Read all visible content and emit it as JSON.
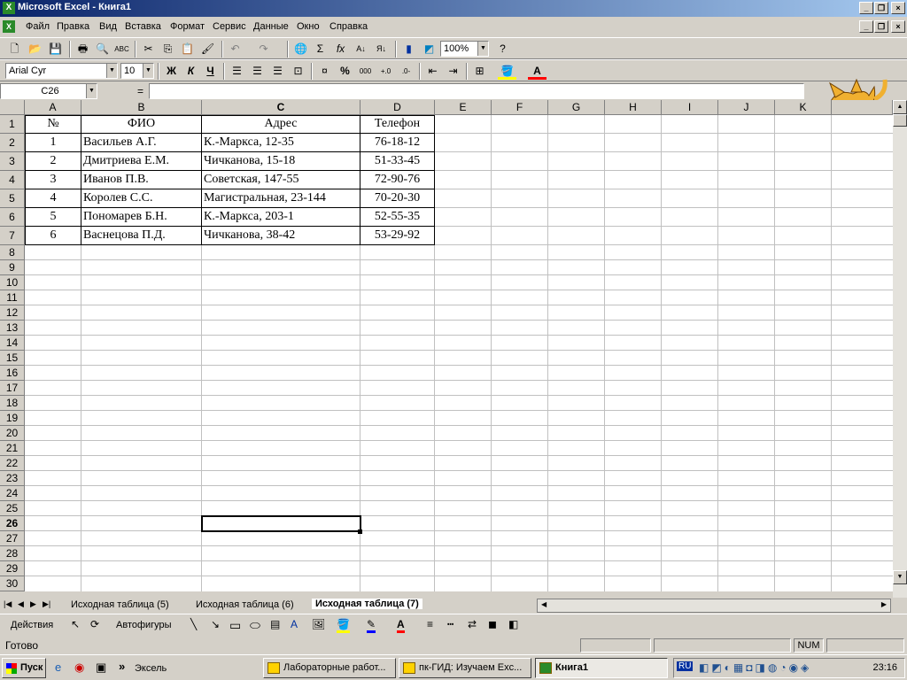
{
  "window": {
    "title": "Microsoft Excel - Книга1",
    "app_icon": "X"
  },
  "menu": [
    "Файл",
    "Правка",
    "Вид",
    "Вставка",
    "Формат",
    "Сервис",
    "Данные",
    "Окно",
    "Справка"
  ],
  "toolbar1": {
    "zoom": "100%"
  },
  "toolbar2": {
    "font": "Arial Cyr",
    "size": "10",
    "bold": "Ж",
    "italic": "К",
    "underline": "Ч",
    "percent": "%",
    "thousands": "000"
  },
  "formula_bar": {
    "name_box": "C26",
    "equals": "=",
    "value": ""
  },
  "columns": [
    "A",
    "B",
    "C",
    "D",
    "E",
    "F",
    "G",
    "H",
    "I",
    "J",
    "K"
  ],
  "rows": [
    "1",
    "2",
    "3",
    "4",
    "5",
    "6",
    "7",
    "8",
    "9",
    "10",
    "11",
    "12",
    "13",
    "14",
    "15",
    "16",
    "17",
    "18",
    "19",
    "20",
    "21",
    "22",
    "23",
    "24",
    "25",
    "26",
    "27",
    "28",
    "29",
    "30"
  ],
  "table": {
    "headers": [
      "№",
      "ФИО",
      "Адрес",
      "Телефон"
    ],
    "rows": [
      [
        "1",
        "Васильев А.Г.",
        "К.-Маркса, 12-35",
        "76-18-12"
      ],
      [
        "2",
        "Дмитриева Е.М.",
        "Чичканова, 15-18",
        "51-33-45"
      ],
      [
        "3",
        "Иванов П.В.",
        "Советская, 147-55",
        "72-90-76"
      ],
      [
        "4",
        "Королев С.С.",
        "Магистральная, 23-144",
        "70-20-30"
      ],
      [
        "5",
        "Пономарев Б.Н.",
        "К.-Маркса, 203-1",
        "52-55-35"
      ],
      [
        "6",
        "Васнецова П.Д.",
        "Чичканова, 38-42",
        "53-29-92"
      ]
    ]
  },
  "sheets": [
    "Исходная таблица (5)",
    "Исходная таблица (6)",
    "Исходная таблица (7)"
  ],
  "active_sheet": "Исходная таблица (7)",
  "drawing": {
    "actions": "Действия",
    "autoshapes": "Автофигуры"
  },
  "status": {
    "ready": "Готово",
    "num": "NUM"
  },
  "taskbar": {
    "start": "Пуск",
    "quick_more": "»",
    "folder": "Эксель",
    "tasks": [
      "Лабораторные работ...",
      "пк-ГИД: Изучаем Exc...",
      "Книга1"
    ],
    "lang": "RU",
    "clock": "23:16"
  }
}
